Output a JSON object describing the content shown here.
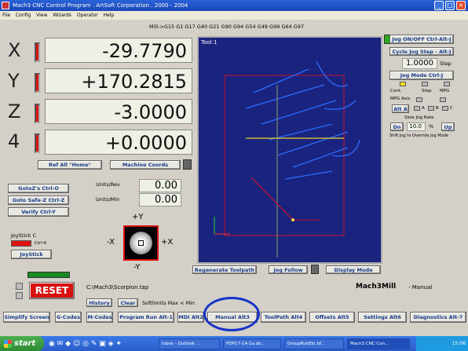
{
  "window": {
    "title": "Mach3 CNC Control Program . ArtSoft Corporation . 2000 - 2004"
  },
  "menu": [
    "File",
    "Config",
    "View",
    "Wizards",
    "Operator",
    "Help"
  ],
  "modal_codes": "Mill->G15  G1 G17 G40 G21 G90 G94 G54 G49 G99 G64 G97",
  "dro": [
    {
      "axis": "X",
      "value": "-29.7790"
    },
    {
      "axis": "Y",
      "value": "+170.2815"
    },
    {
      "axis": "Z",
      "value": "-3.0000"
    },
    {
      "axis": "4",
      "value": "+0.0000"
    }
  ],
  "buttons": {
    "ref_all": "Ref All \"Home\"",
    "machine_coords": "Machine Coords",
    "gotoz": "GotoZ's Ctrl-O",
    "goto_safe_z": "Goto Safe-Z Ctrl-Z",
    "verify": "Verify Ctrl-Y",
    "jogstick": "JoyStick",
    "reset": "RESET",
    "history": "History",
    "clear": "Clear",
    "regen_toolpath": "Regenerate Toolpath",
    "jog_follow": "Jog Follow",
    "display_mode": "Display Mode",
    "jog_onoff": "Jog ON/OFF Ctrl-Alt-J",
    "cycle_jog": "Cycle Jog Step - Alt-J",
    "jog_mode": "Jog Mode Ctrl-J",
    "alt_a": "Alt A",
    "dn": "Dn",
    "up": "Up"
  },
  "feed": {
    "units_rev_label": "Units/Rev",
    "units_rev_value": "0.00",
    "units_min_label": "Units/Min",
    "units_min_value": "0.00"
  },
  "joystick": {
    "label": "JoyStick C",
    "ctrl_label": "Ctrl-6",
    "plus_y": "+Y",
    "minus_y": "-Y",
    "plus_x": "+X",
    "minus_x": "-X"
  },
  "toolpath": {
    "tool_label": "Tool:1"
  },
  "jog": {
    "step_value": "1.0000",
    "step_label": "Step",
    "cont": "Cont.",
    "step": "Step",
    "mpg": "MPG",
    "mpg_axis": "MPG Axis",
    "mpg_a": "A",
    "mpg_b": "B",
    "mpg_c": "C",
    "slow_jog_rate": "Slow Jog Rate",
    "rate_value": "10.0",
    "rate_unit": "%",
    "shift_text": "Shift Jog to Override Jog Mode"
  },
  "status": {
    "file_path": "C:\\Mach3\\Scorpion.tap",
    "softlimits": "Softlimits Max < Min",
    "profile": "Mach3Mill",
    "mode": "- Manual"
  },
  "tabs": [
    {
      "label": "Simplify Screen"
    },
    {
      "label": "G-Codes"
    },
    {
      "label": "M-Codes"
    },
    {
      "label": "Program Run Alt-1"
    },
    {
      "label": "MDI Alt2"
    },
    {
      "label": "Manual Alt3"
    },
    {
      "label": "ToolPath Alt4"
    },
    {
      "label": "Offsets Alt5"
    },
    {
      "label": "Settings Alt6"
    },
    {
      "label": "Diagnostics Alt-7"
    }
  ],
  "taskbar": {
    "start": "start",
    "tasks": [
      "Inbox - Outlook ...",
      "PDP17-1A-1a.do...",
      "GroupRunEtc.bf...",
      "Mach3 CNC Con..."
    ],
    "clock": "15:06"
  },
  "colors": {
    "titlebar": "#1947b8",
    "toolpath_bg": "#1a237e",
    "reset": "#d81010",
    "highlight": "#1633c8"
  }
}
